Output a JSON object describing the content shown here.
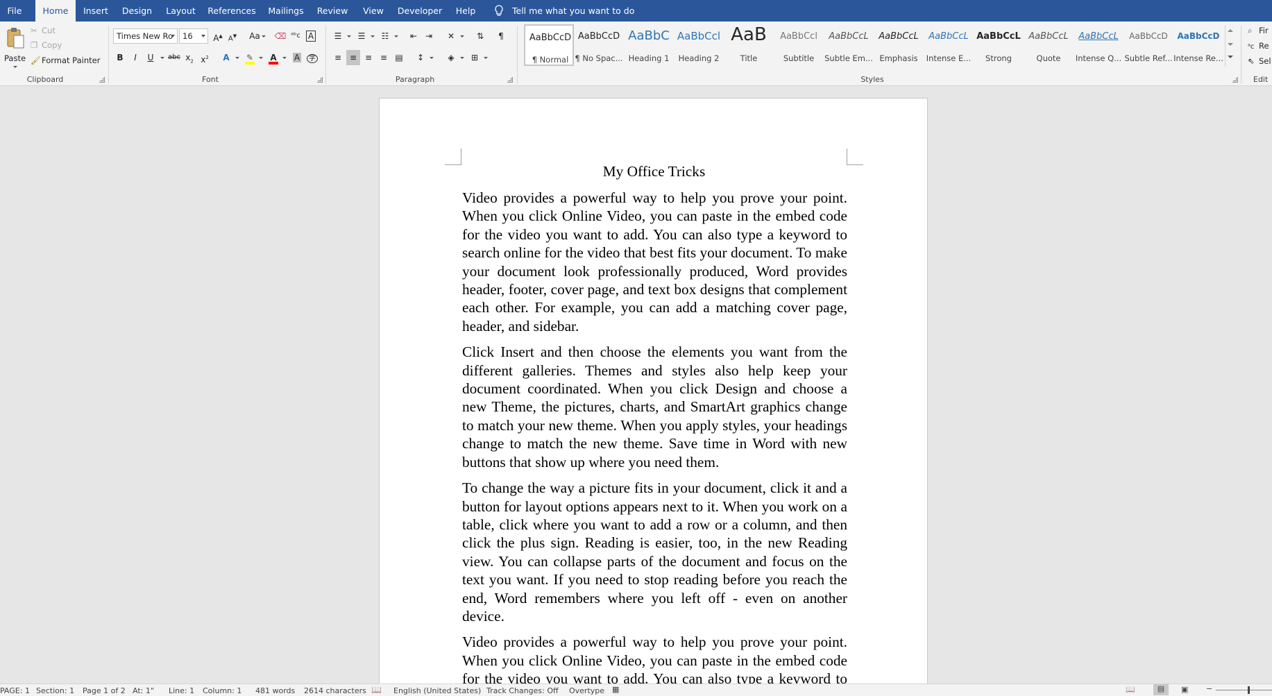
{
  "tabs": [
    {
      "label": "File",
      "active": false
    },
    {
      "label": "Home",
      "active": true
    },
    {
      "label": "Insert",
      "active": false
    },
    {
      "label": "Design",
      "active": false
    },
    {
      "label": "Layout",
      "active": false
    },
    {
      "label": "References",
      "active": false
    },
    {
      "label": "Mailings",
      "active": false
    },
    {
      "label": "Review",
      "active": false
    },
    {
      "label": "View",
      "active": false
    },
    {
      "label": "Developer",
      "active": false
    },
    {
      "label": "Help",
      "active": false
    }
  ],
  "tell_me": "Tell me what you want to do",
  "colors": {
    "title_bar": "#2b579a",
    "ribbon_bg": "#f3f3f3",
    "workspace_bg": "#e6e6e6",
    "page_bg": "#ffffff",
    "highlight_yellow": "#ffff00",
    "font_color_red": "#ff0000",
    "link_blue": "#2e74b5"
  },
  "clipboard": {
    "paste": "Paste",
    "cut": "Cut",
    "copy": "Copy",
    "format_painter": "Format Painter",
    "group_label": "Clipboard"
  },
  "font": {
    "name": "Times New Ro",
    "size": "16",
    "case_label": "Aa",
    "group_label": "Font"
  },
  "paragraph": {
    "group_label": "Paragraph",
    "alignment": "center"
  },
  "styles": {
    "group_label": "Styles",
    "items": [
      {
        "preview": "AaBbCcD",
        "name": "¶ Normal",
        "selected": true
      },
      {
        "preview": "AaBbCcD",
        "name": "¶ No Spac...",
        "selected": false
      },
      {
        "preview": "AaBbC",
        "name": "Heading 1",
        "selected": false
      },
      {
        "preview": "AaBbCcl",
        "name": "Heading 2",
        "selected": false
      },
      {
        "preview": "AaB",
        "name": "Title",
        "selected": false
      },
      {
        "preview": "AaBbCcl",
        "name": "Subtitle",
        "selected": false
      },
      {
        "preview": "AaBbCcL",
        "name": "Subtle Em...",
        "selected": false
      },
      {
        "preview": "AaBbCcL",
        "name": "Emphasis",
        "selected": false
      },
      {
        "preview": "AaBbCcL",
        "name": "Intense E...",
        "selected": false
      },
      {
        "preview": "AaBbCcL",
        "name": "Strong",
        "selected": false
      },
      {
        "preview": "AaBbCcL",
        "name": "Quote",
        "selected": false
      },
      {
        "preview": "AaBbCcL",
        "name": "Intense Q...",
        "selected": false
      },
      {
        "preview": "AaBbCcD",
        "name": "Subtle Ref...",
        "selected": false
      },
      {
        "preview": "AaBbCcD",
        "name": "Intense Re...",
        "selected": false
      }
    ]
  },
  "editing": {
    "find": "Fir",
    "replace": "Re",
    "select": "Sel",
    "group_label": "Edit"
  },
  "document": {
    "title": "My Office Tricks",
    "paragraphs": [
      "Video provides a powerful way to help you prove your point. When you click Online Video, you can paste in the embed code for the video you want to add. You can also type a keyword to search online for the video that best fits your document. To make your document look professionally produced, Word provides header, footer, cover page, and text box designs that complement each other. For example, you can add a matching cover page, header, and sidebar.",
      "Click Insert and then choose the elements you want from the different galleries. Themes and styles also help keep your document coordinated. When you click Design and choose a new Theme, the pictures, charts, and SmartArt graphics change to match your new theme. When you apply styles, your headings change to match the new theme. Save time in Word with new buttons that show up where you need them.",
      "To change the way a picture fits in your document, click it and a button for layout options appears next to it. When you work on a table, click where you want to add a row or a column, and then click the plus sign. Reading is easier, too, in the new Reading view. You can collapse parts of the document and focus on the text you want. If you need to stop reading before you reach the end, Word remembers where you left off - even on another device.",
      "Video provides a powerful way to help you prove your point. When you click Online Video, you can paste in the embed code for the video you want to add. You can also type a keyword to search online for the video that best fits your document. To make"
    ]
  },
  "status": {
    "page": "PAGE: 1",
    "section": "Section: 1",
    "page_of": "Page 1 of 2",
    "at": "At: 1\"",
    "line": "Line: 1",
    "column": "Column: 1",
    "words": "481 words",
    "characters": "2614 characters",
    "language": "English (United States)",
    "track_changes": "Track Changes: Off",
    "overtype": "Overtype"
  }
}
